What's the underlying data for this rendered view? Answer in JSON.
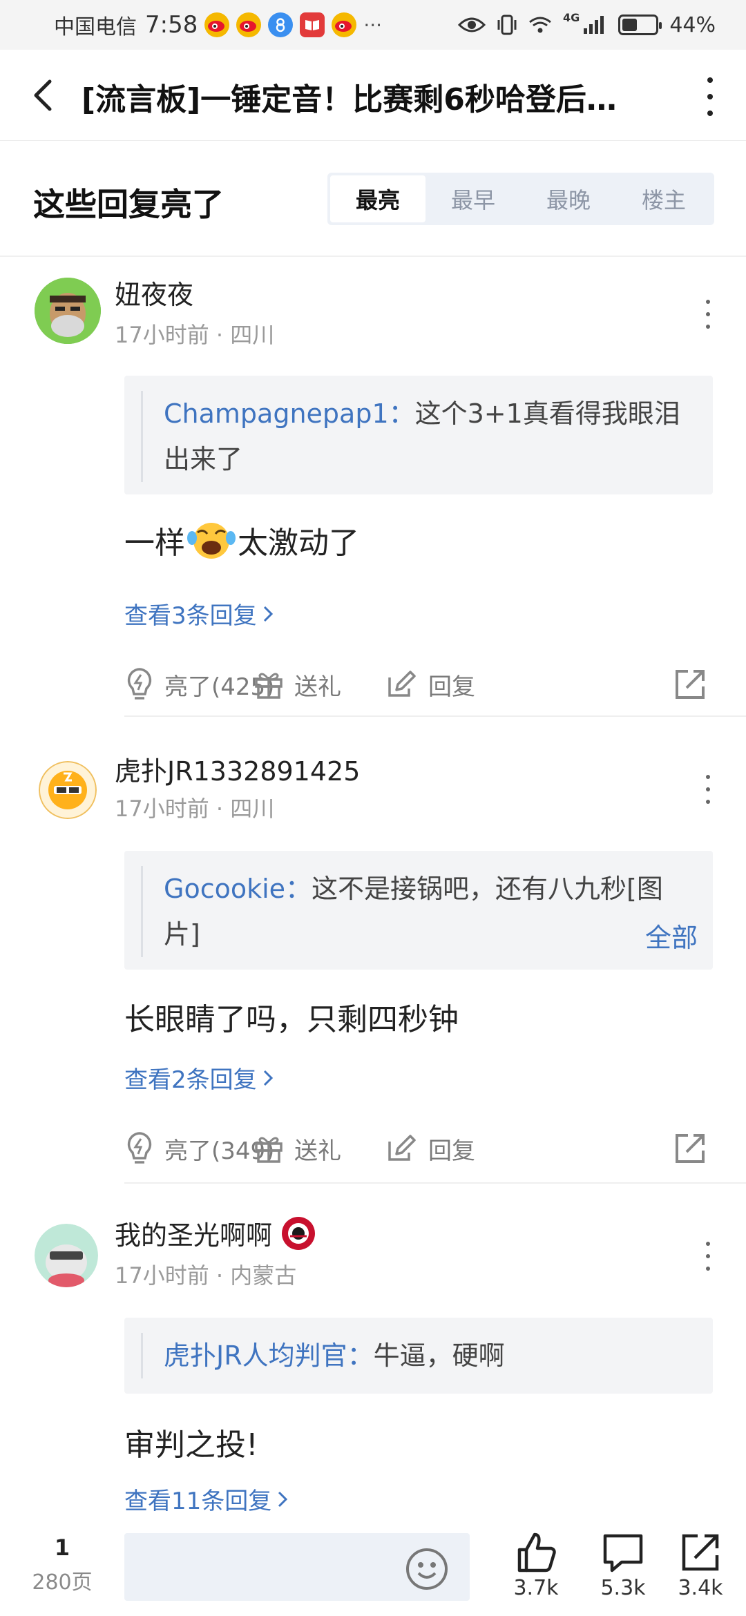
{
  "status_bar": {
    "carrier": "中国电信",
    "time": "7:58",
    "network": "4G",
    "battery": "44%",
    "battery_level": 0.44
  },
  "header": {
    "title": "[流言板]一锤定音！比赛剩6秒哈登后…"
  },
  "section": {
    "title": "这些回复亮了",
    "sort_tabs": [
      "最亮",
      "最早",
      "最晚",
      "楼主"
    ],
    "active_tab": "最亮"
  },
  "comments": [
    {
      "username": "妞夜夜",
      "time": "17小时前",
      "location": "四川",
      "quote_user": "Champagnepap1：",
      "quote_text": "这个3+1真看得我眼泪出来了",
      "body_before": "一样",
      "body_emoji": "crying-laughing-emoji",
      "body_after": "太激动了",
      "view_replies": "查看3条回复",
      "likes": "亮了(425)",
      "gift": "送礼",
      "reply": "回复"
    },
    {
      "username": "虎扑JR1332891425",
      "time": "17小时前",
      "location": "四川",
      "quote_user": "Gocookie：",
      "quote_text": "这不是接锅吧，还有八九秒[图片]",
      "quote_all": "全部",
      "body": "长眼睛了吗，只剩四秒钟",
      "view_replies": "查看2条回复",
      "likes": "亮了(349)",
      "gift": "送礼",
      "reply": "回复"
    },
    {
      "username": "我的圣光啊啊",
      "time": "17小时前",
      "location": "内蒙古",
      "quote_user": "虎扑JR人均判官：",
      "quote_text": "牛逼，硬啊",
      "body": "审判之投!",
      "view_replies": "查看11条回复"
    }
  ],
  "bottom_bar": {
    "page_current": "1",
    "page_total": "280页",
    "likes_count": "3.7k",
    "comments_count": "5.3k",
    "shares_count": "3.4k"
  }
}
